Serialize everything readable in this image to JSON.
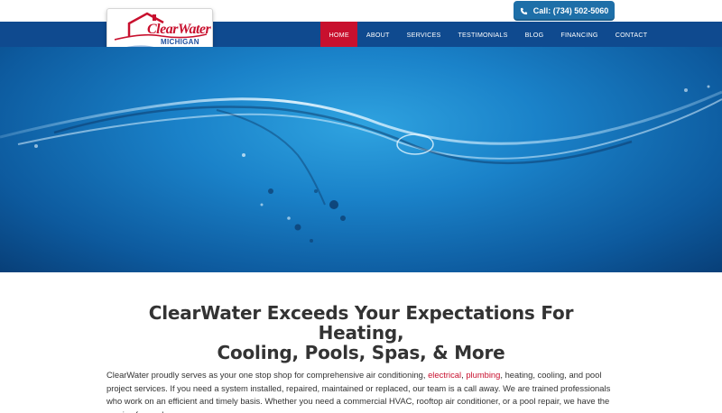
{
  "header": {
    "call_label": "Call: (734) 502-5060",
    "logo_word": "ClearWater",
    "logo_sub": "MICHIGAN"
  },
  "nav": {
    "items": [
      {
        "label": "HOME",
        "active": true
      },
      {
        "label": "ABOUT"
      },
      {
        "label": "SERVICES"
      },
      {
        "label": "TESTIMONIALS"
      },
      {
        "label": "BLOG"
      },
      {
        "label": "FINANCING"
      },
      {
        "label": "CONTACT"
      }
    ]
  },
  "main": {
    "headline_line1": "ClearWater Exceeds Your Expectations For Heating,",
    "headline_line2": "Cooling, Pools, Spas, & More",
    "para_part1": "ClearWater proudly serves as your one stop shop for comprehensive air conditioning, ",
    "link_electrical": "electrical",
    "comma": ", ",
    "link_plumbing": "plumbing",
    "para_part2": ", heating, cooling, and pool project services. If you need a system installed, repaired, maintained or replaced, our team is a call away. We are trained professionals who work on an efficient and timely basis. Whether you need a commercial HVAC, rooftop air conditioner, or a pool repair, we have the service for you!"
  },
  "colors": {
    "nav_bg": "#0f4a8f",
    "active": "#c8102e",
    "call_btn": "#1e6fa8",
    "link": "#c8102e"
  }
}
